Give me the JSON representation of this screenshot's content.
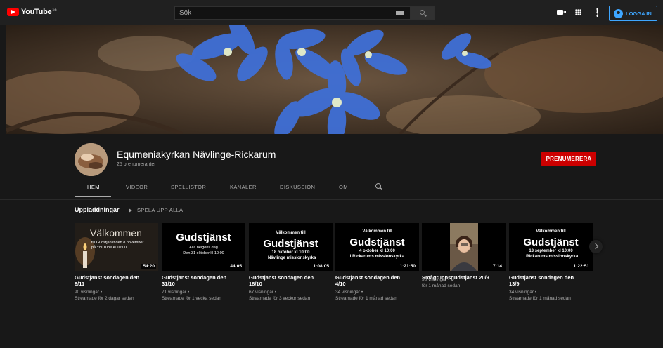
{
  "masthead": {
    "logo_text": "YouTube",
    "logo_country": "SE",
    "search_placeholder": "Sök",
    "signin_label": "LOGGA IN"
  },
  "channel": {
    "name": "Equmeniakyrkan Nävlinge-Rickarum",
    "subscribers": "25 prenumeranter",
    "subscribe_label": "PRENUMERERA"
  },
  "tabs": [
    {
      "label": "HEM",
      "active": true
    },
    {
      "label": "VIDEOR",
      "active": false
    },
    {
      "label": "SPELLISTOR",
      "active": false
    },
    {
      "label": "KANALER",
      "active": false
    },
    {
      "label": "DISKUSSION",
      "active": false
    },
    {
      "label": "OM",
      "active": false
    }
  ],
  "shelf": {
    "title": "Uppladdningar",
    "play_all": "SPELA UPP ALLA"
  },
  "videos": [
    {
      "title_line1": "Gudstjänst söndagen den",
      "title_line2": "8/11",
      "views": "90 visningar",
      "age": "Streamade för 2 dagar sedan",
      "duration": "54:20",
      "thumb_big": "Välkommen",
      "thumb_small1": "till Gudstjänst den 8 november",
      "thumb_small2": "på YouTube kl 10:00"
    },
    {
      "title_line1": "Gudstjänst söndagen den",
      "title_line2": "31/10",
      "views": "71 visningar",
      "age": "Streamade för 1 vecka sedan",
      "duration": "44:05",
      "thumb_big": "Gudstjänst",
      "thumb_small1": "Alla helgons dag",
      "thumb_small2": "Den 31 oktober kl 10:00"
    },
    {
      "title_line1": "Gudstjänst söndagen den",
      "title_line2": "18/10",
      "views": "67 visningar",
      "age": "Streamade för 3 veckor sedan",
      "duration": "1:08:05",
      "thumb_pre": "Välkommen till",
      "thumb_big": "Gudstjänst",
      "thumb_small1": "18 oktober kl 10:00",
      "thumb_small2": "i Nävlinge missionskyrka"
    },
    {
      "title_line1": "Gudstjänst söndagen den",
      "title_line2": "4/10",
      "views": "34 visningar",
      "age": "Streamade för 1 månad sedan",
      "duration": "1:21:50",
      "thumb_pre": "Välkommen till",
      "thumb_big": "Gudstjänst",
      "thumb_small1": "4 oktober kl 10:00",
      "thumb_small2": "i Rickarums missionskyrka"
    },
    {
      "title_line1": "Smågruppsgudstjänst 20/9",
      "title_line2": "",
      "views": "38 visningar",
      "age": "för 1 månad sedan",
      "duration": "7:14"
    },
    {
      "title_line1": "Gudstjänst söndagen den",
      "title_line2": "13/9",
      "views": "34 visningar",
      "age": "Streamade för 1 månad sedan",
      "duration": "1:22:51",
      "thumb_pre": "Välkommen till",
      "thumb_big": "Gudstjänst",
      "thumb_small1": "13 september kl 10:00",
      "thumb_small2": "i Rickarums missionskyrka"
    }
  ],
  "colors": {
    "masthead_bg": "#202020",
    "page_bg": "#181818",
    "subscribe_red": "#cc0000",
    "signin_blue": "#3ea6ff"
  }
}
